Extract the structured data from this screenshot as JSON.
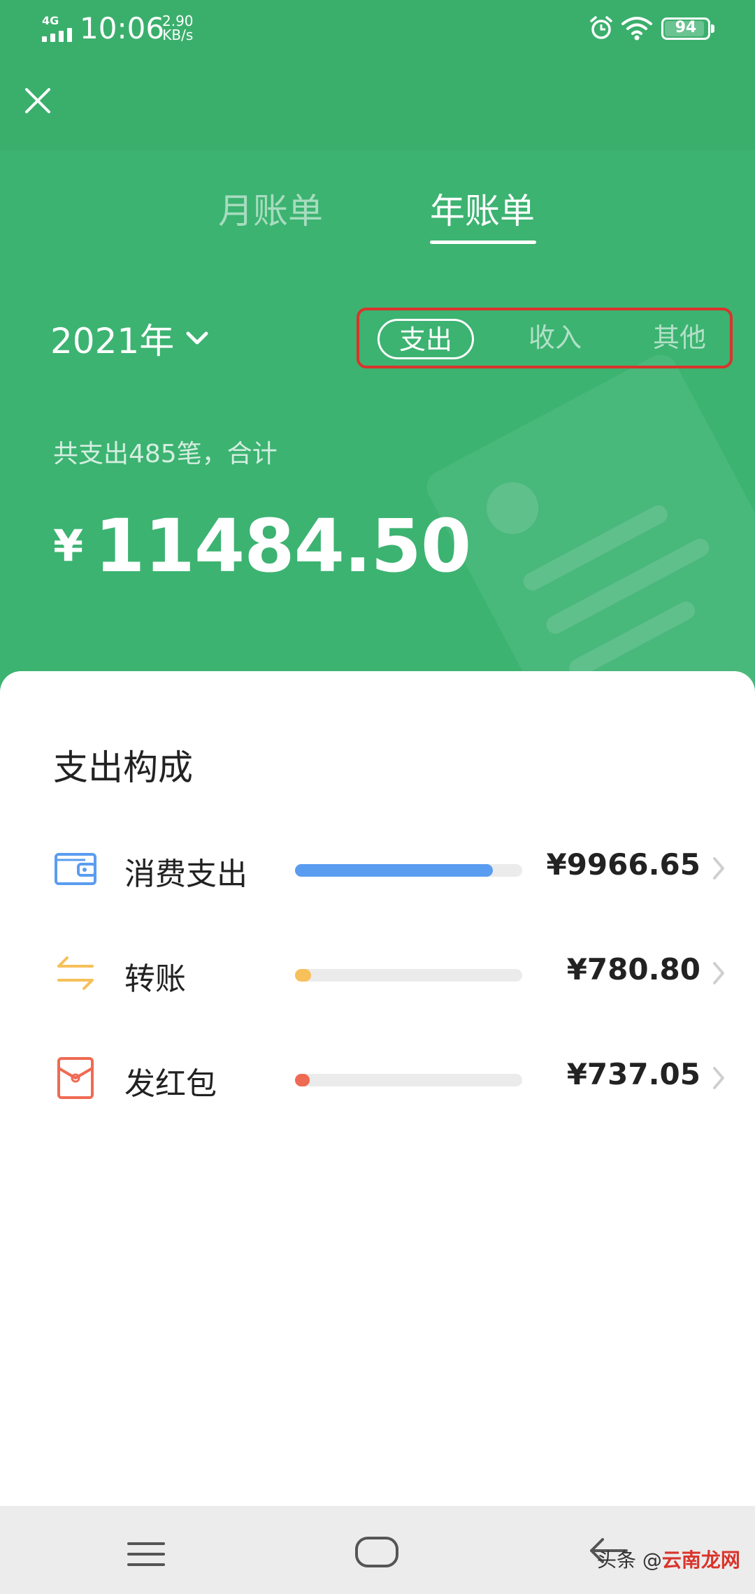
{
  "status_bar": {
    "network": "4G",
    "time": "10:06",
    "speed_value": "2.90",
    "speed_unit": "KB/s",
    "battery": "94"
  },
  "tabs": {
    "month": "月账单",
    "year": "年账单",
    "selected": "年账单"
  },
  "year_selector": {
    "value": "2021年"
  },
  "filters": {
    "expense": "支出",
    "income": "收入",
    "other": "其他",
    "selected": "支出"
  },
  "summary": {
    "text": "共支出485笔，合计",
    "currency": "¥",
    "amount": "11484.50"
  },
  "section": {
    "title": "支出构成",
    "items": [
      {
        "label": "消费支出",
        "amount": "¥9966.65",
        "share": 0.87,
        "color": "#5a9df0",
        "icon": "wallet-icon"
      },
      {
        "label": "转账",
        "amount": "¥780.80",
        "share": 0.07,
        "color": "#f7c05a",
        "icon": "transfer-icon"
      },
      {
        "label": "发红包",
        "amount": "¥737.05",
        "share": 0.064,
        "color": "#ef6a52",
        "icon": "red-packet-icon"
      }
    ]
  },
  "watermark": {
    "prefix": "头条 @",
    "suffix": "云南龙网"
  },
  "colors": {
    "header": "#3cb371",
    "highlight": "#d9342b"
  }
}
